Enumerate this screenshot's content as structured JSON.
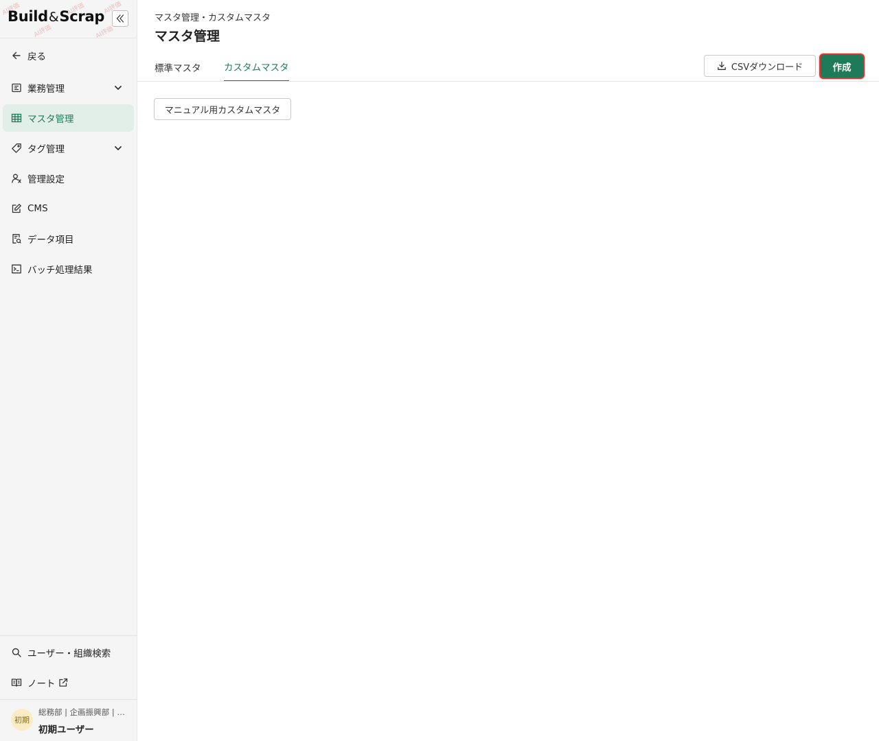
{
  "sidebar": {
    "logo": {
      "part1": "Build",
      "amp": "&",
      "part2": "Scrap"
    },
    "watermark": "AI評価",
    "back_label": "戻る",
    "items": [
      {
        "label": "業務管理",
        "icon": "board-icon",
        "expandable": true
      },
      {
        "label": "マスタ管理",
        "icon": "table-icon",
        "active": true
      },
      {
        "label": "タグ管理",
        "icon": "tag-icon",
        "expandable": true
      },
      {
        "label": "管理設定",
        "icon": "user-settings-icon"
      },
      {
        "label": "CMS",
        "icon": "edit-icon"
      },
      {
        "label": "データ項目",
        "icon": "data-doc-icon"
      },
      {
        "label": "バッチ処理結果",
        "icon": "terminal-icon"
      }
    ],
    "bottom_items": [
      {
        "label": "ユーザー・組織検索",
        "icon": "search-icon"
      },
      {
        "label": "ノート",
        "icon": "book-icon",
        "external": true
      }
    ],
    "user": {
      "avatar_text": "初期",
      "org": "総務部 | 企画振興部 | …",
      "name": "初期ユーザー"
    }
  },
  "header": {
    "breadcrumb": "マスタ管理・カスタムマスタ",
    "title": "マスタ管理"
  },
  "tabs": [
    {
      "label": "標準マスタ",
      "active": false
    },
    {
      "label": "カスタムマスタ",
      "active": true
    }
  ],
  "actions": {
    "csv_label": "CSVダウンロード",
    "create_label": "作成"
  },
  "content": {
    "chips": [
      "マニュアル用カスタムマスタ"
    ]
  },
  "colors": {
    "accent": "#1f7a5a",
    "active_bg": "#e2eee8",
    "highlight_border": "#e0322f",
    "sidebar_bg": "#f5f5f5",
    "avatar_bg": "#faedc6"
  }
}
